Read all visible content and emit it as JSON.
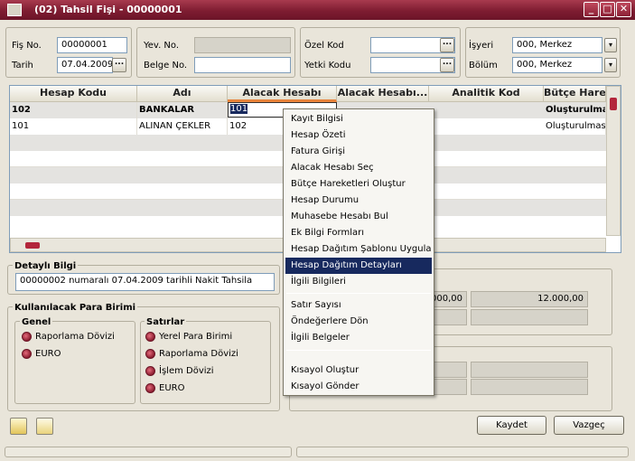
{
  "window": {
    "title": "(02) Tahsil Fişi - 00000001",
    "min": "_",
    "max": "□",
    "close": "✕"
  },
  "header": {
    "fis_no_label": "Fiş No.",
    "fis_no": "00000001",
    "tarih_label": "Tarih",
    "tarih": "07.04.2009",
    "yev_no_label": "Yev. No.",
    "belge_no_label": "Belge No.",
    "ozel_kod_label": "Özel Kod",
    "yetki_kodu_label": "Yetki Kodu",
    "isyeri_label": "İşyeri",
    "isyeri": "000, Merkez",
    "bolum_label": "Bölüm",
    "bolum": "000, Merkez",
    "dots": "...",
    "combo": "▾"
  },
  "grid": {
    "columns": [
      "Hesap Kodu",
      "Adı",
      "Alacak Hesabı",
      "Alacak Hesabı...",
      "Analitik Kod",
      "Bütçe Hare"
    ],
    "rows": [
      {
        "hesap_kodu": "102",
        "adi": "BANKALAR",
        "alacak": "101",
        "butce": "Oluşturulma"
      },
      {
        "hesap_kodu": "101",
        "adi": "ALINAN ÇEKLER",
        "alacak": "102",
        "butce": "Oluşturulmasın"
      }
    ]
  },
  "detail": {
    "title": "Detaylı Bilgi",
    "text": "00000002 numaralı 07.04.2009 tarihli Nakit Tahsila"
  },
  "currency": {
    "title": "Kullanılacak Para Birimi",
    "genel_title": "Genel",
    "genel": [
      "Raporlama Dövizi",
      "EURO"
    ],
    "satirlar_title": "Satırlar",
    "satirlar": [
      "Yerel Para Birimi",
      "Raporlama Dövizi",
      "İşlem Dövizi",
      "EURO"
    ]
  },
  "totals": {
    "v1": "000,00",
    "v2": "12.000,00"
  },
  "context_menu": {
    "group1": [
      "Kayıt Bilgisi",
      "Hesap Özeti",
      "Fatura Girişi",
      "Alacak Hesabı Seç",
      "Bütçe Hareketleri Oluştur",
      "Hesap Durumu",
      "Muhasebe Hesabı Bul",
      "Ek Bilgi Formları",
      "Hesap Dağıtım Şablonu Uygula",
      "Hesap Dağıtım Detayları",
      "İlgili Bilgileri"
    ],
    "group2": [
      "Satır Sayısı",
      "Öndeğerlere Dön",
      "İlgili Belgeler"
    ],
    "group3": [
      "Kısayol Oluştur",
      "Kısayol Gönder"
    ],
    "selected": "Hesap Dağıtım Detayları"
  },
  "buttons": {
    "kaydet": "Kaydet",
    "vazgec": "Vazgeç"
  }
}
